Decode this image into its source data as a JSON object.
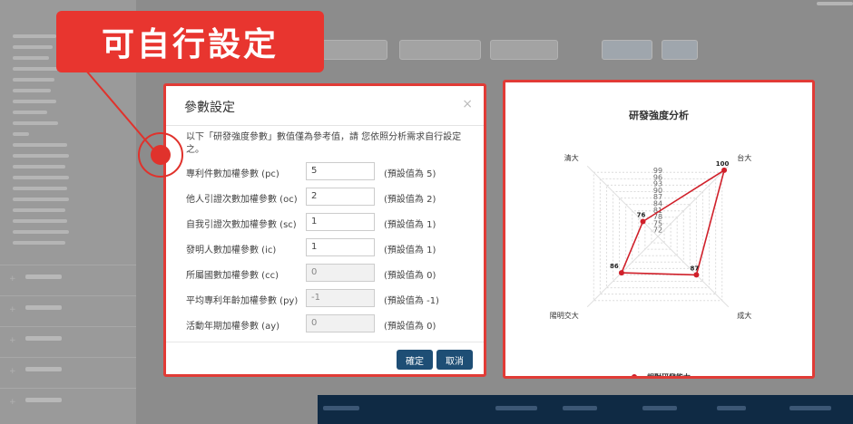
{
  "callout": {
    "text": "可自行設定"
  },
  "modal": {
    "title": "參數設定",
    "close_label": "×",
    "intro": "以下「研發強度參數」數值僅為參考值，請 您依照分析需求自行設定之。",
    "params": [
      {
        "label": "專利件數加權參數 (pc)",
        "value": "5",
        "default": "(預設值為 5)",
        "readonly": false
      },
      {
        "label": "他人引證次數加權參數 (oc)",
        "value": "2",
        "default": "(預設值為 2)",
        "readonly": false
      },
      {
        "label": "自我引證次數加權參數 (sc)",
        "value": "1",
        "default": "(預設值為 1)",
        "readonly": false
      },
      {
        "label": "發明人數加權參數 (ic)",
        "value": "1",
        "default": "(預設值為 1)",
        "readonly": false
      },
      {
        "label": "所屬國數加權參數 (cc)",
        "value": "0",
        "default": "(預設值為 0)",
        "readonly": true
      },
      {
        "label": "平均專利年齡加權參數 (py)",
        "value": "-1",
        "default": "(預設值為 -1)",
        "readonly": true
      },
      {
        "label": "活動年期加權參數 (ay)",
        "value": "0",
        "default": "(預設值為 0)",
        "readonly": true
      }
    ],
    "confirm_label": "確定",
    "cancel_label": "取消"
  },
  "colors": {
    "accent_red": "#e13b36",
    "primary_button": "#1e4e75",
    "series": "#d0202a"
  },
  "chart_data": {
    "type": "radar",
    "title": "研發強度分析",
    "categories": [
      "台大",
      "成大",
      "陽明交大",
      "清大"
    ],
    "radial_ticks": [
      72,
      75,
      78,
      81,
      84,
      87,
      90,
      93,
      96,
      99
    ],
    "rlim": [
      69,
      102
    ],
    "series": [
      {
        "name": "相對研發能力",
        "values": [
          100,
          87,
          86,
          76
        ]
      }
    ],
    "data_labels": [
      "100",
      "87",
      "86",
      "76"
    ],
    "legend_position": "bottom"
  }
}
